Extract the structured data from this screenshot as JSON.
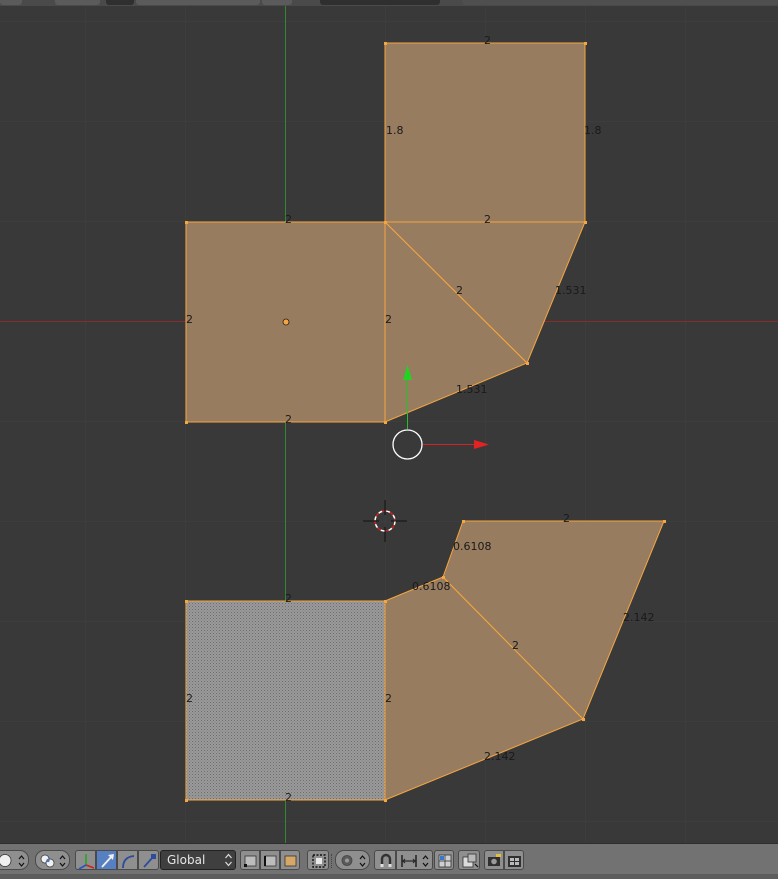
{
  "viewport": {
    "edge_labels": {
      "top_square_top": "2",
      "top_square_left": "1.8",
      "top_square_right": "1.8",
      "center_square_top_left": "2",
      "center_square_top_right": "2",
      "center_square_left": "2",
      "center_square_shared": "2",
      "center_square_bottom": "2",
      "wedge_diagonal": "2",
      "wedge_right": "1.531",
      "wedge_bottom": "1.531",
      "lower_top": "2",
      "lower_short_a": "0.6108",
      "lower_short_b": "0.6108",
      "lower_right": "2.142",
      "lower_diagonal": "2",
      "lower_bottom": "2.142",
      "grey_top": "2",
      "grey_left": "2",
      "grey_right": "2",
      "grey_bottom": "2"
    }
  },
  "toolbar": {
    "orientation_value": "Global"
  },
  "colors": {
    "background": "#393939",
    "face": "#977c5f",
    "edge": "#f5a640",
    "unselected_face": "#8a8a8a",
    "x_axis": "#8a2b2b",
    "y_axis": "#2f8a2f",
    "footer": "#727272",
    "active_button": "#5680c2"
  }
}
